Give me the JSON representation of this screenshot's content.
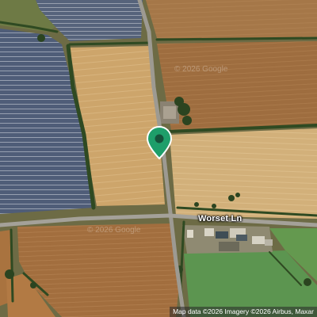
{
  "map": {
    "type": "satellite",
    "road_label": "Worset Ln",
    "watermark_text": "© 2026 Google",
    "attribution": "Map data ©2026 Imagery ©2026 Airbus, Maxar",
    "pin_icon": "location-pin-icon",
    "pin_color": "#1e9e6a",
    "colors": {
      "solar_panels": "#4f5d78",
      "wheat_field": "#c9a36a",
      "brown_field": "#9a6b3e",
      "grass_field": "#5f9450",
      "hedgerow": "#2f4a22",
      "road": "#9d9a92"
    }
  }
}
